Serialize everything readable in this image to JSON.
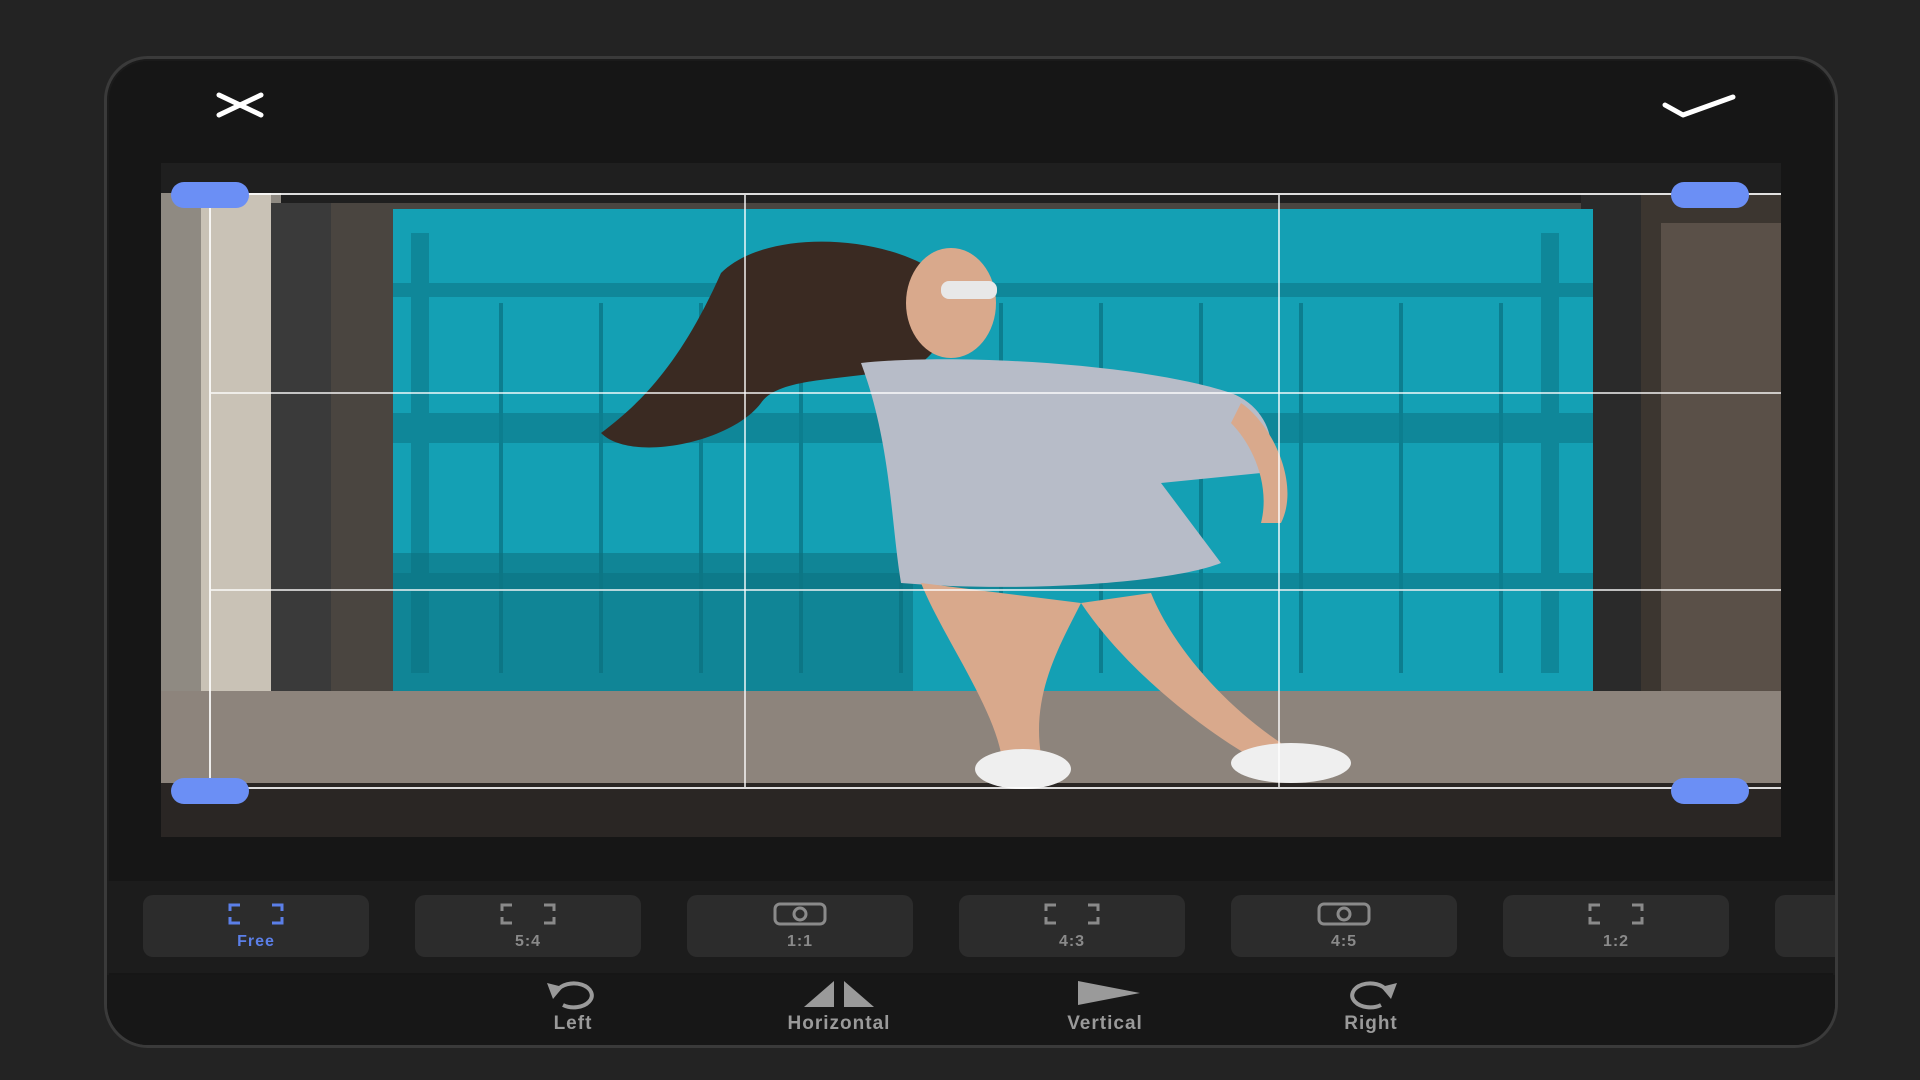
{
  "editor": {
    "close_icon": "close-icon",
    "confirm_icon": "checkmark-icon",
    "accent_color": "#6b8ff5"
  },
  "aspect_ratios": [
    {
      "label": "Free",
      "icon": "free-crop-icon",
      "active": true
    },
    {
      "label": "5:4",
      "icon": "crop-frame-icon",
      "active": false
    },
    {
      "label": "1:1",
      "icon": "instagram-icon",
      "active": false
    },
    {
      "label": "4:3",
      "icon": "crop-frame-icon",
      "active": false
    },
    {
      "label": "4:5",
      "icon": "instagram-icon",
      "active": false
    },
    {
      "label": "1:2",
      "icon": "crop-frame-icon",
      "active": false
    }
  ],
  "rotate_actions": [
    {
      "label": "Left",
      "icon": "rotate-left-icon"
    },
    {
      "label": "Horizontal",
      "icon": "flip-horizontal-icon"
    },
    {
      "label": "Vertical",
      "icon": "flip-vertical-icon"
    },
    {
      "label": "Right",
      "icon": "rotate-right-icon"
    }
  ]
}
